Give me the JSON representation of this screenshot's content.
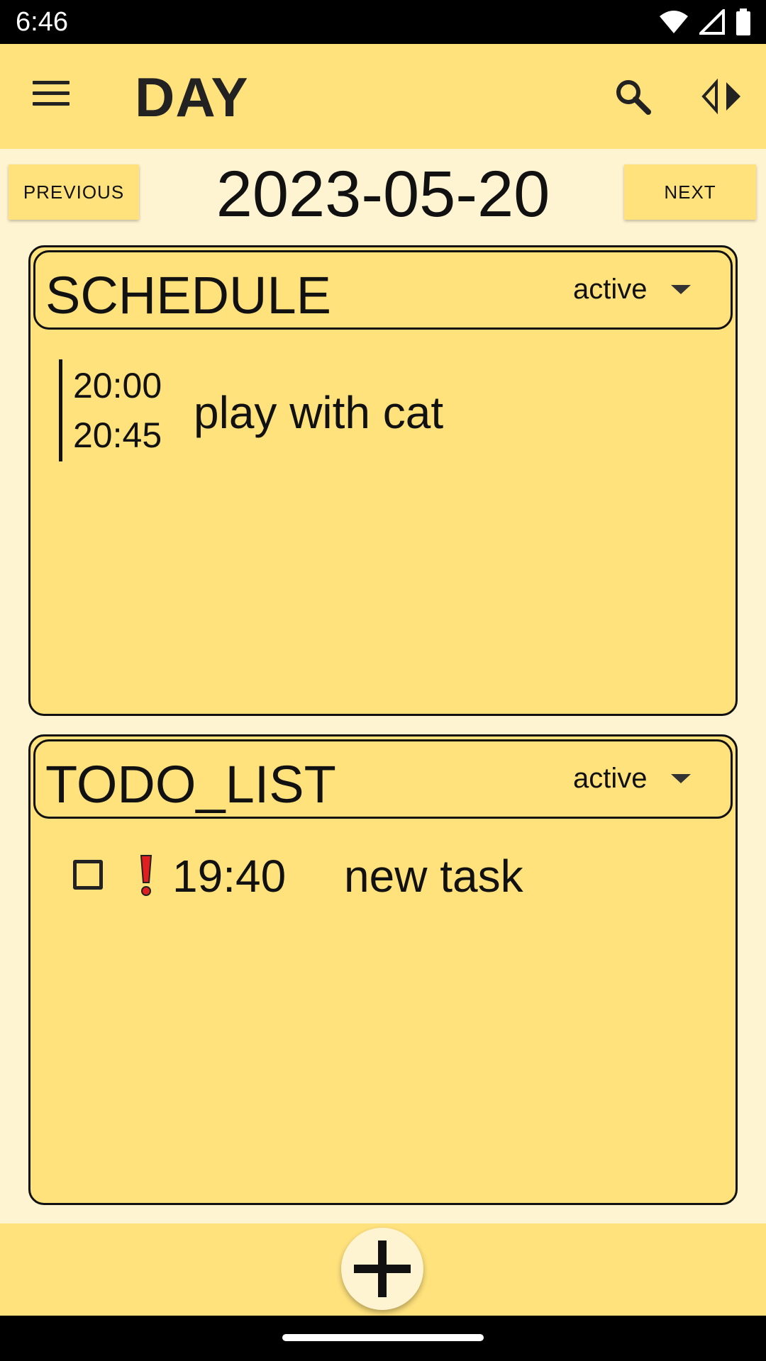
{
  "status_bar": {
    "time": "6:46"
  },
  "app_bar": {
    "title": "DAY"
  },
  "date_nav": {
    "previous_label": "PREVIOUS",
    "date": "2023-05-20",
    "next_label": "NEXT"
  },
  "schedule": {
    "title": "SCHEDULE",
    "filter": "active",
    "items": [
      {
        "start": "20:00",
        "end": "20:45",
        "title": "play with cat"
      }
    ]
  },
  "todo": {
    "title": "TODO_LIST",
    "filter": "active",
    "items": [
      {
        "time": "19:40",
        "title": "new task",
        "checked": false,
        "priority": "high"
      }
    ]
  },
  "colors": {
    "background": "#FFF4D2",
    "bar": "#FFE27C",
    "priority": "#E02020"
  },
  "icons": [
    "menu-icon",
    "search-icon",
    "arrows-icon",
    "priority-icon",
    "add-icon",
    "wifi-icon",
    "signal-icon",
    "battery-icon"
  ]
}
